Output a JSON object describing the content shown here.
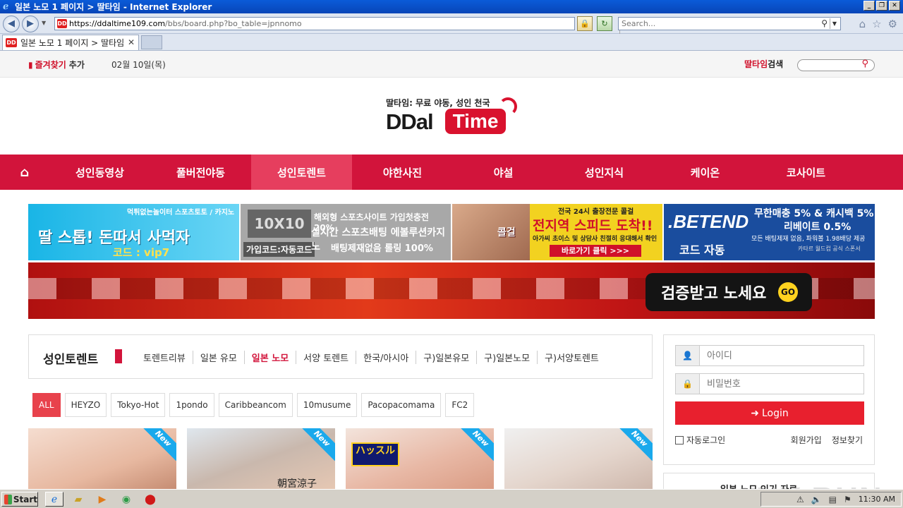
{
  "window": {
    "title": "일본 노모 1 페이지 > 딸타임 - Internet Explorer"
  },
  "browser": {
    "address_host": "https://ddaltime109.com",
    "address_path": "/bbs/board.php?bo_table=jpnnomo",
    "search_placeholder": "Search...",
    "tab_label": "일본 노모 1 페이지 > 딸타임"
  },
  "topbar": {
    "favorites_label": "즐겨찾기",
    "favorites_add": "추가",
    "date": "02월 10일(목)",
    "search_label_red": "딸타임",
    "search_label_black": "검색"
  },
  "logo": {
    "tagline": "딸타임: 무료 야동, 성인 천국",
    "word_left": "DDal",
    "word_right": "Time"
  },
  "nav": {
    "home_icon": "home-icon",
    "items": [
      "성인동영상",
      "풀버전야동",
      "성인토렌트",
      "야한사진",
      "야설",
      "성인지식",
      "케이온",
      "코사이트"
    ],
    "active_index": 2
  },
  "banners": {
    "b1": {
      "top": "먹튀없는놀이터 스포츠토토 / 카지노",
      "main": "딸 스톱! 돈따서 사먹자",
      "code": "코드 : vip7"
    },
    "b2": {
      "logo": "10X10",
      "code": "가입코드:자동코드",
      "l1": "해외형 스포츠사이트 가입첫충전 20%",
      "l2": "실시간 스포츠배팅 에볼루션카지노",
      "l3": "배팅제재없음 롤링 100%"
    },
    "b3": {
      "brand": "콜걸",
      "l1": "전국 24시 출장전문 콜걸",
      "l2": "전지역 스피드 도착!!",
      "l3": "아가씨 초이스 및 상담사 친절히 응대해서 확인",
      "button": "바로가기 클릭 >>>"
    },
    "b4": {
      "logo": ".BETEND",
      "code": "코드 자동",
      "l1": "무한매충 5% & 캐시백 5%",
      "l2": "리베이트 0.5%",
      "l3": "모든 배팅제재 없음, 파워볼 1.98배당 제공",
      "small": "카타르 월드컵 공식 스폰서"
    }
  },
  "wide_banner": {
    "verify_text": "검증받고 노세요",
    "go_text": "GO"
  },
  "board": {
    "title": "성인토렌트",
    "sub_nav": [
      "토렌트리뷰",
      "일본 유모",
      "일본 노모",
      "서양 토렌트",
      "한국/아시아",
      "구)일본유모",
      "구)일본노모",
      "구)서양토렌트"
    ],
    "sub_active_index": 2,
    "categories": [
      "ALL",
      "HEYZO",
      "Tokyo-Hot",
      "1pondo",
      "Caribbeancom",
      "10musume",
      "Pacopacomama",
      "FC2"
    ],
    "category_active_index": 0,
    "thumbs": [
      {
        "ribbon": "New"
      },
      {
        "ribbon": "New",
        "caption": "朝宮涼子"
      },
      {
        "ribbon": "New",
        "badge": "ハッスル"
      },
      {
        "ribbon": "New"
      }
    ]
  },
  "login": {
    "id_placeholder": "아이디",
    "pw_placeholder": "비밀번호",
    "button": "Login",
    "auto_login": "자동로그인",
    "register": "회원가입",
    "find_info": "정보찾기",
    "next_box_title": "일본 노모 인기 자료"
  },
  "watermark": "ANY RUN",
  "taskbar": {
    "start": "Start",
    "clock": "11:30 AM"
  }
}
